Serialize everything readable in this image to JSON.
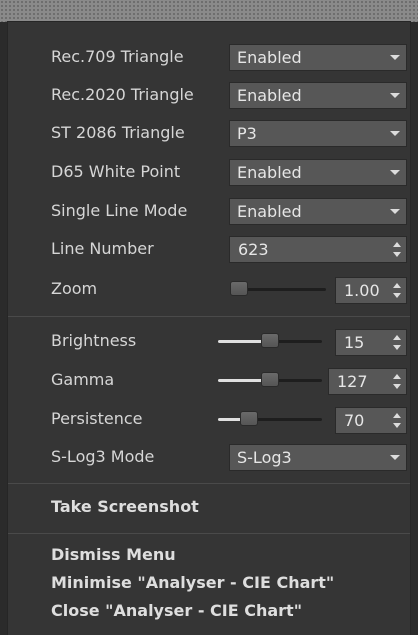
{
  "menu": {
    "rec709": {
      "label": "Rec.709 Triangle",
      "value": "Enabled"
    },
    "rec2020": {
      "label": "Rec.2020 Triangle",
      "value": "Enabled"
    },
    "st2086": {
      "label": "ST 2086 Triangle",
      "value": "P3"
    },
    "d65": {
      "label": "D65 White Point",
      "value": "Enabled"
    },
    "single_line": {
      "label": "Single Line Mode",
      "value": "Enabled"
    },
    "line_number": {
      "label": "Line Number",
      "value": "623"
    },
    "zoom": {
      "label": "Zoom",
      "value": "1.00",
      "level": 0.0
    },
    "brightness": {
      "label": "Brightness",
      "value": "15",
      "level": 0.5
    },
    "gamma": {
      "label": "Gamma",
      "value": "127",
      "level": 0.5
    },
    "persistence": {
      "label": "Persistence",
      "value": "70",
      "level": 0.25
    },
    "slog3": {
      "label": "S-Log3 Mode",
      "value": "S-Log3"
    },
    "take_screenshot": "Take Screenshot",
    "dismiss": "Dismiss Menu",
    "minimise": "Minimise \"Analyser - CIE Chart\"",
    "close": "Close \"Analyser - CIE Chart\""
  },
  "colors": {
    "menu_bg": "#353535",
    "control_bg": "#575757",
    "text": "#d6d6d6"
  }
}
